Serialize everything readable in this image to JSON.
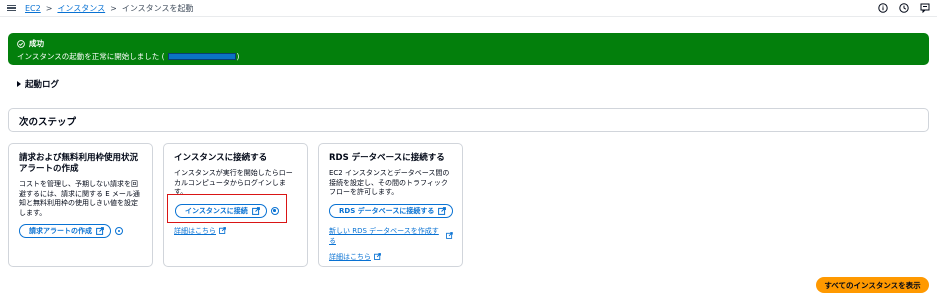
{
  "breadcrumb": {
    "ec2": "EC2",
    "instances": "インスタンス",
    "current": "インスタンスを起動"
  },
  "icons": {
    "menu": "hamburger-icon",
    "info": "info-icon",
    "history": "history-icon",
    "feedback": "feedback-icon",
    "success": "check-circle-icon",
    "external": "external-link-icon",
    "alarm": "notification-icon",
    "expand": "caret-right-icon"
  },
  "flash": {
    "title": "成功",
    "message_prefix": "インスタンスの起動を正常に開始しました (",
    "message_suffix": ")",
    "color": "#037f0c"
  },
  "launch_log": "起動ログ",
  "next_steps": "次のステップ",
  "cards": {
    "billing": {
      "title": "請求および無料利用枠使用状況アラートの作成",
      "desc": "コストを管理し、予期しない請求を回避するには、請求に関する E メール通知と無料利用枠の使用しきい値を設定します。",
      "button": "請求アラートの作成"
    },
    "connect": {
      "title": "インスタンスに接続する",
      "desc": "インスタンスが実行を開始したらローカルコンピュータからログインします。",
      "button": "インスタンスに接続",
      "link": "詳細はこちら"
    },
    "rds": {
      "title": "RDS データベースに接続する",
      "desc": "EC2 インスタンスとデータベース間の接続を設定し、その間のトラフィックフローを許可します。",
      "button": "RDS データベースに接続する",
      "link_create": "新しい RDS データベースを作成する",
      "link": "詳細はこちら"
    }
  },
  "view_all_button": "すべてのインスタンスを表示",
  "colors": {
    "link": "#0972d3",
    "primary": "#ff9900",
    "highlight": "#d91515"
  }
}
